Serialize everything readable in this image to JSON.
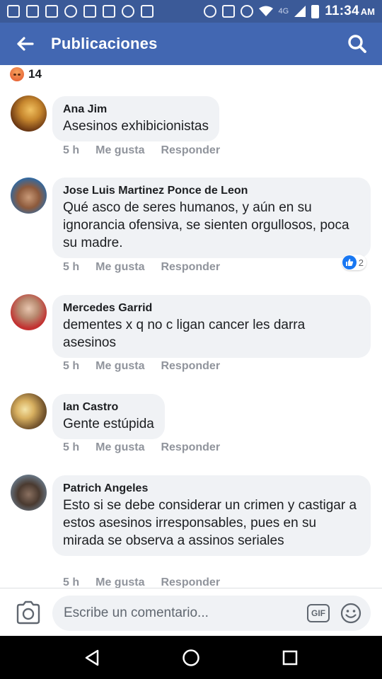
{
  "status_bar": {
    "network": "4G",
    "time": "11:34",
    "ampm": "AM"
  },
  "header": {
    "title": "Publicaciones",
    "back_icon": "back-arrow-icon",
    "search_icon": "search-icon"
  },
  "reactions": {
    "type": "angry",
    "count": "14"
  },
  "comments": [
    {
      "author": "Ana Jim",
      "text": "Asesinos exhibicionistas",
      "time": "5 h",
      "like_label": "Me gusta",
      "reply_label": "Responder"
    },
    {
      "author": "Jose Luis Martinez Ponce de Leon",
      "text": "Qué asco de seres humanos, y aún en su ignorancia ofensiva, se sienten orgullosos, poca su madre.",
      "time": "5 h",
      "like_label": "Me gusta",
      "reply_label": "Responder",
      "likes": "2"
    },
    {
      "author": "Mercedes Garrid",
      "text": "dementes x q no c ligan cancer les darra asesinos",
      "time": "5 h",
      "like_label": "Me gusta",
      "reply_label": "Responder"
    },
    {
      "author": "Ian Castro",
      "text": "Gente estúpida",
      "time": "5 h",
      "like_label": "Me gusta",
      "reply_label": "Responder"
    },
    {
      "author": "Patrich Angeles",
      "text": "Esto si se debe considerar un crimen y castigar a estos asesinos irresponsables, pues en su mirada se observa a assinos seriales",
      "time": "5 h",
      "like_label": "Me gusta",
      "reply_label": "Responder"
    }
  ],
  "composer": {
    "placeholder": "Escribe un comentario...",
    "gif_label": "GIF"
  },
  "colors": {
    "status_bar": "#3b5a98",
    "app_bar": "#4267b2",
    "bubble": "#f0f2f5",
    "action_text": "#90949c",
    "like_blue": "#1877f2"
  }
}
